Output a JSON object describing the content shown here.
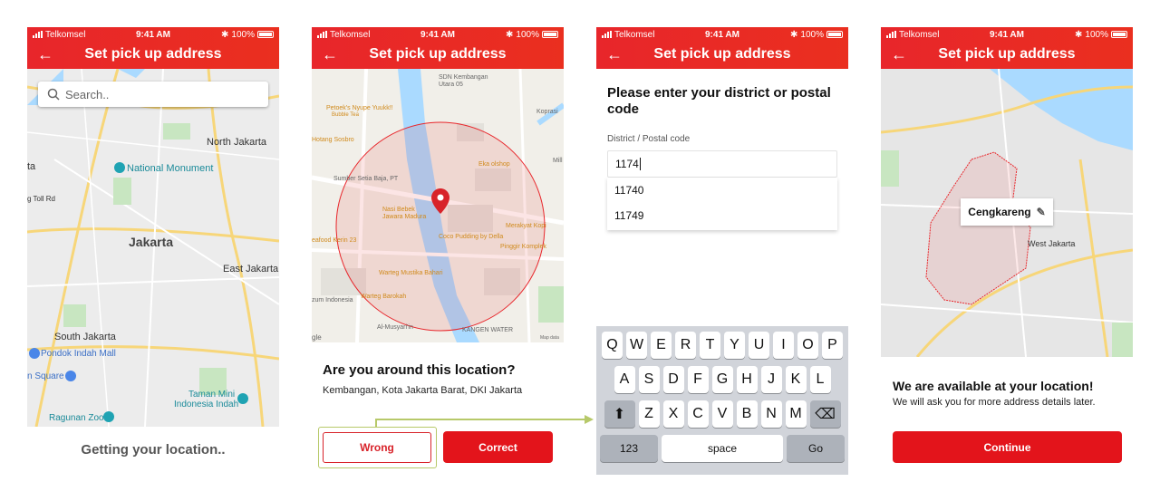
{
  "statusbar": {
    "carrier": "Telkomsel",
    "time": "9:41 AM",
    "battery": "100%"
  },
  "screens": [
    {
      "title": "Set pick up address",
      "search_placeholder": "Search..",
      "map_labels": {
        "north": "North Jakarta",
        "monument": "National Monument",
        "center": "Jakarta",
        "east": "East Jakarta",
        "south": "South Jakarta",
        "pondok": "Pondok Indah Mall",
        "square": "n Square",
        "taman": "Taman Mini",
        "taman2": "Indonesia Indah",
        "ragunan": "Ragunan Zoo",
        "ta": "ta",
        "tollrd": "g Toll Rd"
      },
      "caption": "Getting your location.."
    },
    {
      "title": "Set pick up address",
      "map_labels": {
        "sdn": "SDN Kembangan",
        "sdn2": "Utara 05",
        "petoek": "Petoek's Nyupe Yuukk!!",
        "bubble": "Bubble Tea",
        "hotang": "Hotang Sosbro",
        "kopras": "Koprasi",
        "eka": "Eka olshop",
        "sumber": "Sumber Setia Baja, PT",
        "mill": "Mill",
        "nasi": "Nasi Bebek",
        "nasi2": "Jawara Madura",
        "merakyat": "Merakyat Kopi",
        "seafood": "eafood Kerin 23",
        "coco": "Coco Pudding by Della",
        "pinggir": "Pinggir Komplek",
        "warteg": "Warteg Mustika Bahari",
        "warteg2": "Warteg Barokah",
        "zum": "zum Indonesia",
        "musyari": "Al-Musyari'in",
        "kangen": "KANGEN WATER",
        "google": "gle",
        "mapdata": "Map data"
      },
      "question": "Are you around this location?",
      "address": "Kembangan, Kota Jakarta Barat, DKI Jakarta",
      "wrong_label": "Wrong",
      "correct_label": "Correct"
    },
    {
      "title": "Set pick up address",
      "heading": "Please enter your district or postal code",
      "field_label": "District / Postal code",
      "input_value": "1174",
      "suggestions": [
        "11740",
        "11749"
      ],
      "keyboard": {
        "row1": [
          "Q",
          "W",
          "E",
          "R",
          "T",
          "Y",
          "U",
          "I",
          "O",
          "P"
        ],
        "row2": [
          "A",
          "S",
          "D",
          "F",
          "G",
          "H",
          "J",
          "K",
          "L"
        ],
        "row3": [
          "Z",
          "X",
          "C",
          "V",
          "B",
          "N",
          "M"
        ],
        "num": "123",
        "space": "space",
        "go": "Go"
      }
    },
    {
      "title": "Set pick up address",
      "area_label": "Cengkareng",
      "map_labels": {
        "west": "West Jakarta"
      },
      "available_title": "We are available at your location!",
      "available_sub": "We will ask you for more address details later.",
      "continue_label": "Continue"
    }
  ],
  "colors": {
    "brand_red": "#e3141b",
    "highlight": "#b7c96a"
  }
}
